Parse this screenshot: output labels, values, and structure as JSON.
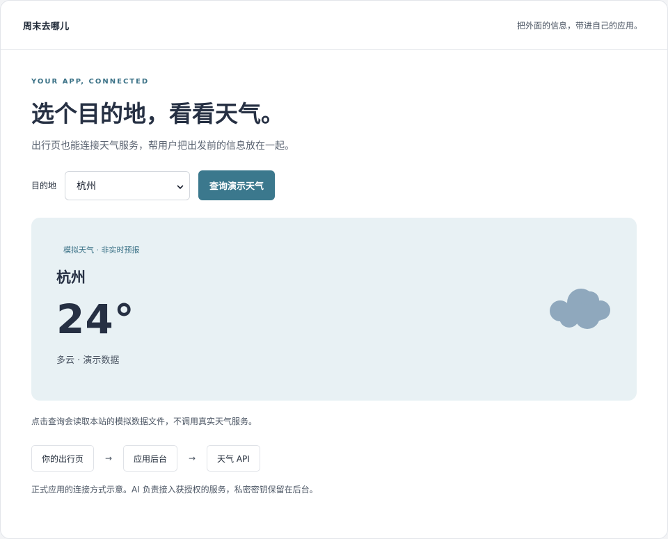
{
  "header": {
    "brand": "周末去哪儿",
    "tagline": "把外面的信息，带进自己的应用。"
  },
  "hero": {
    "eyebrow": "YOUR APP, CONNECTED",
    "title": "选个目的地，看看天气。",
    "subtitle": "出行页也能连接天气服务，帮用户把出发前的信息放在一起。"
  },
  "form": {
    "label": "目的地",
    "selected_city": "杭州",
    "submit_label": "查询演示天气"
  },
  "weather_card": {
    "badge": "模拟天气 · 非实时预报",
    "city": "杭州",
    "temperature": "24°",
    "condition": "多云 · 演示数据",
    "icon": "cloud-icon"
  },
  "note": "点击查询会读取本站的模拟数据文件，不调用真实天气服务。",
  "flow": {
    "steps": [
      "你的出行页",
      "应用后台",
      "天气 API"
    ],
    "arrow": "→",
    "footnote": "正式应用的连接方式示意。AI 负责接入获授权的服务，私密密钥保留在后台。"
  },
  "colors": {
    "accent": "#3b788d",
    "card_bg": "#e8f1f4",
    "cloud": "#8fa8bd",
    "heading": "#263043"
  }
}
